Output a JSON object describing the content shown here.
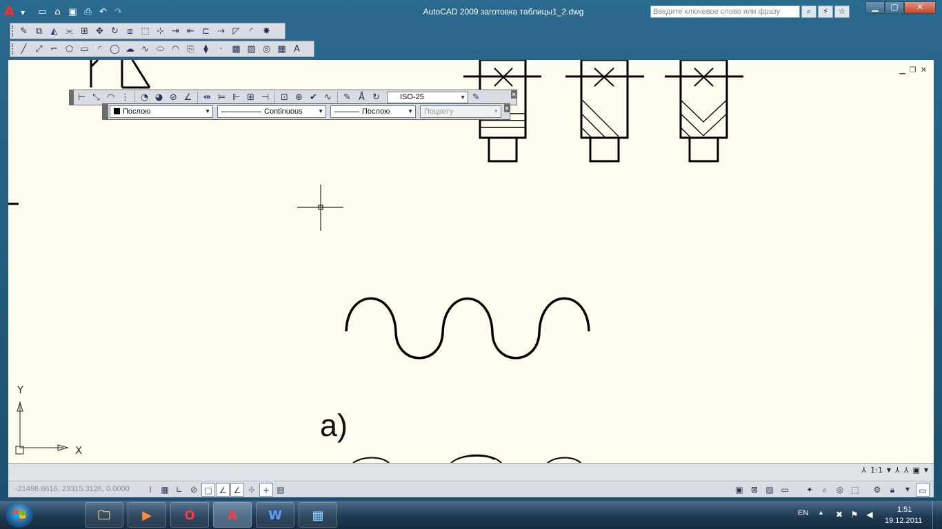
{
  "app": {
    "logo": "A",
    "window_title": "AutoCAD 2009 заготовка таблицы1_2.dwg",
    "search_placeholder": "Введите ключевое слово или фразу"
  },
  "quick_access": [
    "new-icon",
    "open-icon",
    "save-icon",
    "print-icon",
    "undo-icon",
    "redo-icon"
  ],
  "toolbars": {
    "modify": [
      "erase-icon",
      "copy-icon",
      "mirror-icon",
      "offset-icon",
      "array-icon",
      "move-icon",
      "rotate-icon",
      "scale-icon",
      "stretch-icon",
      "trim-icon",
      "extend-icon",
      "break-at-point-icon",
      "break-icon",
      "join-icon",
      "chamfer-icon",
      "fillet-icon",
      "explode-icon"
    ],
    "draw": [
      "line-icon",
      "construction-line-icon",
      "polyline-icon",
      "polygon-icon",
      "rectangle-icon",
      "arc-icon",
      "circle-icon",
      "revision-cloud-icon",
      "spline-icon",
      "ellipse-icon",
      "ellipse-arc-icon",
      "insert-block-icon",
      "make-block-icon",
      "point-icon",
      "hatch-icon",
      "gradient-icon",
      "region-icon",
      "table-icon",
      "multiline-text-icon"
    ]
  },
  "dimension_toolbar": {
    "dim_style": "ISO-25"
  },
  "properties_toolbar": {
    "color": "Послою",
    "linetype": "Continuous",
    "lineweight": "Послою",
    "plot_style": "Поцвету"
  },
  "canvas": {
    "annotation": "a)",
    "axis_y": "Y",
    "axis_x": "X",
    "background": "#fffdef"
  },
  "status": {
    "coordinates": "-21496.6616, 23315.3126, 0.0000",
    "annotation_scale": "1:1"
  },
  "taskbar": {
    "apps": [
      {
        "name": "explorer",
        "label": "",
        "active": false
      },
      {
        "name": "media-player",
        "label": "",
        "active": false
      },
      {
        "name": "opera",
        "label": "O",
        "active": false
      },
      {
        "name": "autocad",
        "label": "A",
        "active": true
      },
      {
        "name": "word",
        "label": "W",
        "active": false
      },
      {
        "name": "control-panel",
        "label": "",
        "active": false
      }
    ],
    "language": "EN",
    "time": "1:51",
    "date": "19.12.2011"
  }
}
